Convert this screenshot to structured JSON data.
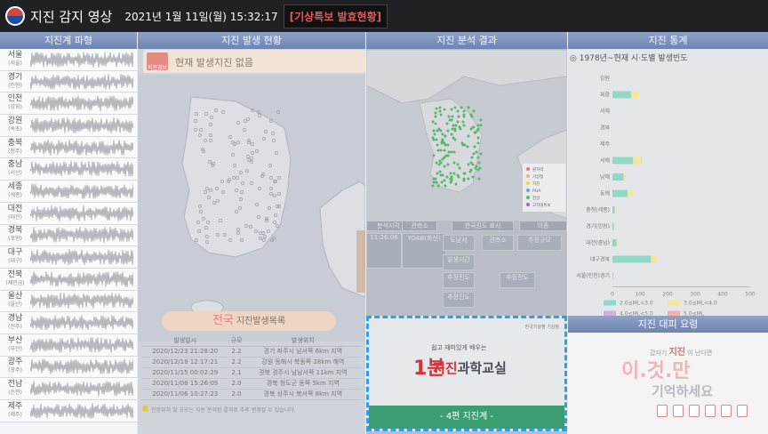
{
  "header": {
    "app_title": "지진 감지 영상",
    "datetime": "2021년 1월 11일(월) 15:32:17",
    "warning_button": "[기상특보 발효현황]"
  },
  "panels": {
    "waveform": "지진계 파형",
    "occurrence": "지진 발생 현황",
    "analysis": "지진 분석 결과",
    "statistics": "지진 통계",
    "guide": "지진 대피 요령"
  },
  "stations": [
    {
      "name": "서울",
      "sub": "(서울)"
    },
    {
      "name": "경기",
      "sub": "(인천)"
    },
    {
      "name": "인천",
      "sub": "(강화)"
    },
    {
      "name": "강원",
      "sub": "(속초)"
    },
    {
      "name": "충북",
      "sub": "(청주)"
    },
    {
      "name": "충남",
      "sub": "(서산)"
    },
    {
      "name": "세종",
      "sub": "(세종)"
    },
    {
      "name": "대전",
      "sub": "(대전)"
    },
    {
      "name": "경북",
      "sub": "(포항)"
    },
    {
      "name": "대구",
      "sub": "(대구)"
    },
    {
      "name": "전북",
      "sub": "(새만금)"
    },
    {
      "name": "울산",
      "sub": "(울산)"
    },
    {
      "name": "경남",
      "sub": "(진주)"
    },
    {
      "name": "부산",
      "sub": "(부산)"
    },
    {
      "name": "광주",
      "sub": "(광주)"
    },
    {
      "name": "전남",
      "sub": "(순천)"
    },
    {
      "name": "제주",
      "sub": "(제주)"
    }
  ],
  "occurrence": {
    "alert_badge": "지진경보",
    "alert_text": "현재 발생지진 없음",
    "list_title_accent": "전국",
    "list_title": "지진발생목록",
    "columns": [
      "발생일시",
      "규모",
      "발생위치"
    ],
    "rows": [
      [
        "2020/12/23 21:28:20",
        "2.2",
        "경기 파주시 남서쪽 6km 지역"
      ],
      [
        "2020/12/18 12:17:21",
        "2.2",
        "강원 동해시 북동쪽 28km 해역"
      ],
      [
        "2020/11/15 00:02:29",
        "2.1",
        "경북 경주시 남남서쪽 11km 지역"
      ],
      [
        "2020/11/08 15:26:09",
        "2.0",
        "경북 청도군 동쪽 5km 지역"
      ],
      [
        "2020/11/06 10:27:23",
        "2.0",
        "경북 상주시 북서쪽 8km 지역"
      ]
    ],
    "footnote": "진앙위치 및 규모는 자동 분석된 결과로 추후 변경될 수 있습니다."
  },
  "analysis": {
    "legend": [
      "원자력",
      "기상청",
      "지진",
      "PGA",
      "진앙",
      "고지대특보"
    ],
    "cells": {
      "header1": "분석시각",
      "header2": "관측소",
      "header3": "진도",
      "legend_label": "한국진도 표시",
      "legend_value": "이종",
      "time_value": "11:26:06",
      "station_value": "YOAB(화산)",
      "label_location": "도남서",
      "label_scale": "관측소",
      "label_depth": "추정규모",
      "label_time": "발생시간",
      "label_intensity": "추정진도",
      "label_range": "추정진도",
      "label_epicenter": "추정진도"
    }
  },
  "video": {
    "line1": "쉽고 재미있게 배우는",
    "big": "1분",
    "title_accent": "지진",
    "title": "과학교실",
    "bar": "- 4편 지진계 -",
    "logo": "한국기상청 기상청"
  },
  "statistics": {
    "title": "◎ 1978년~현재 시·도별 발생빈도",
    "chart_data": {
      "type": "bar",
      "stacked": true,
      "categories": [
        "강원",
        "북한",
        "서해",
        "경북",
        "제주",
        "서해",
        "남해",
        "동해",
        "충청(세종)",
        "경기(인천)",
        "대전(충남)",
        "대구경북",
        "서울(인천)경기"
      ],
      "series": [
        {
          "name": "2.0≤ML<3.0",
          "color": "#8ed9c8",
          "values": [
            0,
            68,
            0,
            0,
            0,
            75,
            40,
            55,
            8,
            5,
            15,
            140,
            3
          ]
        },
        {
          "name": "3.0≤ML<4.0",
          "color": "#f3e79b",
          "values": [
            0,
            28,
            0,
            0,
            0,
            30,
            8,
            20,
            3,
            1,
            5,
            20,
            1
          ]
        },
        {
          "name": "4.0≤ML<5.0",
          "color": "#c7b4e4",
          "values": [
            0,
            0,
            0,
            0,
            0,
            1,
            0,
            0,
            0,
            0,
            0,
            0,
            0
          ]
        },
        {
          "name": "5.0≤ML",
          "color": "#f0b3b3",
          "values": [
            0,
            0,
            0,
            0,
            0,
            0,
            0,
            0,
            0,
            0,
            0,
            0,
            0
          ]
        }
      ],
      "xlim": [
        0,
        500
      ],
      "xticks": [
        "0",
        "100",
        "200",
        "300",
        "400",
        "500"
      ],
      "legend_position": "bottom"
    }
  },
  "guide": {
    "line_small": "갑자기",
    "line_small_accent": "지진",
    "line_small_end": "이 난다면",
    "big": "이.것.만",
    "sub": "기억하세요"
  },
  "colors": {
    "header_bg": "#1f2124",
    "panel_head": "#7b8fbd",
    "warning": "#e25b5b",
    "accent_red": "#d6323a",
    "video_border": "#2ea0e8",
    "epicenter_green": "#55b86f"
  }
}
